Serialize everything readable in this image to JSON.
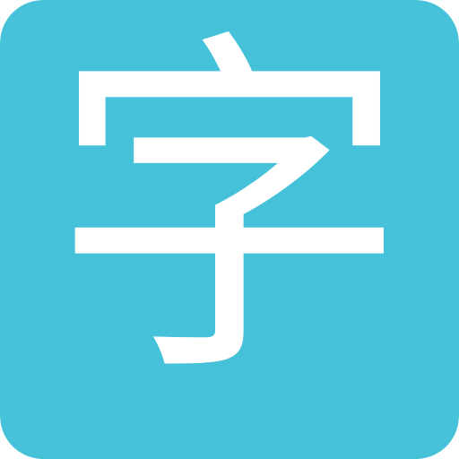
{
  "icon": {
    "name": "chinese-character-zi-icon",
    "glyph": "字",
    "background_color": "#45C1D9",
    "glyph_color": "#FFFFFF"
  }
}
